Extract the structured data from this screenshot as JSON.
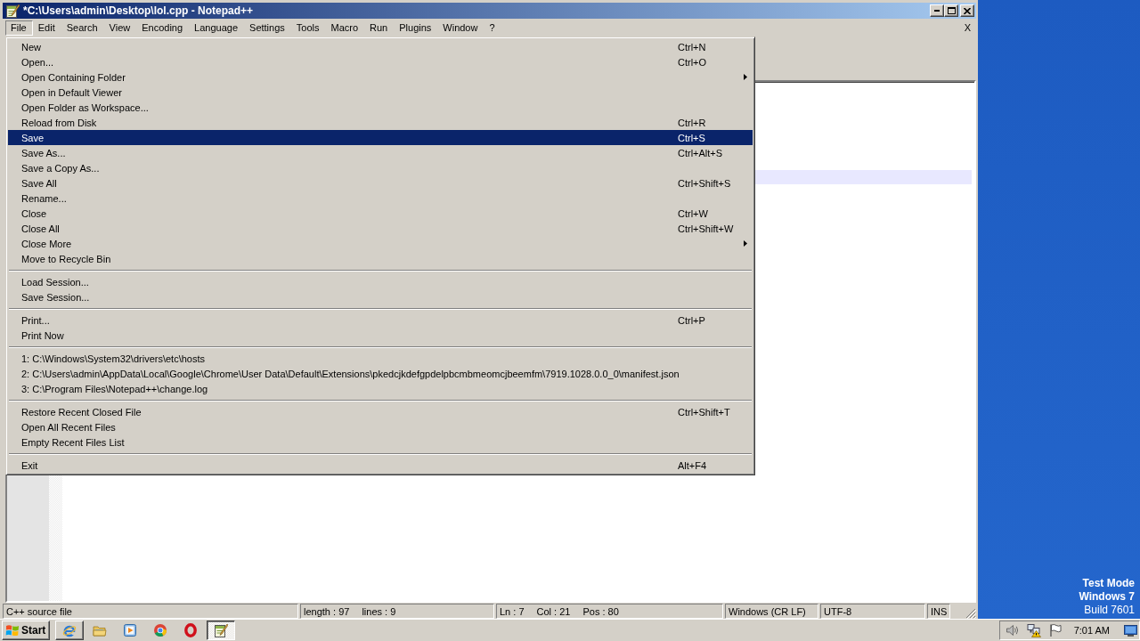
{
  "window": {
    "title": "*C:\\Users\\admin\\Desktop\\lol.cpp - Notepad++",
    "close_document": "X"
  },
  "menu_bar": [
    {
      "label": "File",
      "selected": true
    },
    {
      "label": "Edit",
      "selected": false
    },
    {
      "label": "Search",
      "selected": false
    },
    {
      "label": "View",
      "selected": false
    },
    {
      "label": "Encoding",
      "selected": false
    },
    {
      "label": "Language",
      "selected": false
    },
    {
      "label": "Settings",
      "selected": false
    },
    {
      "label": "Tools",
      "selected": false
    },
    {
      "label": "Macro",
      "selected": false
    },
    {
      "label": "Run",
      "selected": false
    },
    {
      "label": "Plugins",
      "selected": false
    },
    {
      "label": "Window",
      "selected": false
    },
    {
      "label": "?",
      "selected": false
    }
  ],
  "file_menu": {
    "sections": [
      {
        "items": [
          {
            "label": "New",
            "shortcut": "Ctrl+N",
            "submenu": false,
            "selected": false
          },
          {
            "label": "Open...",
            "shortcut": "Ctrl+O",
            "submenu": false,
            "selected": false
          },
          {
            "label": "Open Containing Folder",
            "submenu": true,
            "selected": false
          },
          {
            "label": "Open in Default Viewer",
            "submenu": false,
            "selected": false
          },
          {
            "label": "Open Folder as Workspace...",
            "submenu": false,
            "selected": false
          },
          {
            "label": "Reload from Disk",
            "shortcut": "Ctrl+R",
            "submenu": false,
            "selected": false
          },
          {
            "label": "Save",
            "shortcut": "Ctrl+S",
            "submenu": false,
            "selected": true
          },
          {
            "label": "Save As...",
            "shortcut": "Ctrl+Alt+S",
            "submenu": false,
            "selected": false
          },
          {
            "label": "Save a Copy As...",
            "submenu": false,
            "selected": false
          },
          {
            "label": "Save All",
            "shortcut": "Ctrl+Shift+S",
            "submenu": false,
            "selected": false
          },
          {
            "label": "Rename...",
            "submenu": false,
            "selected": false
          },
          {
            "label": "Close",
            "shortcut": "Ctrl+W",
            "submenu": false,
            "selected": false
          },
          {
            "label": "Close All",
            "shortcut": "Ctrl+Shift+W",
            "submenu": false,
            "selected": false
          },
          {
            "label": "Close More",
            "submenu": true,
            "selected": false
          },
          {
            "label": "Move to Recycle Bin",
            "submenu": false,
            "selected": false
          }
        ]
      },
      {
        "items": [
          {
            "label": "Load Session...",
            "submenu": false,
            "selected": false
          },
          {
            "label": "Save Session...",
            "submenu": false,
            "selected": false
          }
        ]
      },
      {
        "items": [
          {
            "label": "Print...",
            "shortcut": "Ctrl+P",
            "submenu": false,
            "selected": false
          },
          {
            "label": "Print Now",
            "submenu": false,
            "selected": false
          }
        ]
      },
      {
        "items": [
          {
            "label": "1: C:\\Windows\\System32\\drivers\\etc\\hosts",
            "submenu": false,
            "selected": false
          },
          {
            "label": "2: C:\\Users\\admin\\AppData\\Local\\Google\\Chrome\\User Data\\Default\\Extensions\\pkedcjkdefgpdelpbcmbmeomcjbeemfm\\7919.1028.0.0_0\\manifest.json",
            "submenu": false,
            "selected": false
          },
          {
            "label": "3: C:\\Program Files\\Notepad++\\change.log",
            "submenu": false,
            "selected": false
          }
        ]
      },
      {
        "items": [
          {
            "label": "Restore Recent Closed File",
            "shortcut": "Ctrl+Shift+T",
            "submenu": false,
            "selected": false
          },
          {
            "label": "Open All Recent Files",
            "submenu": false,
            "selected": false
          },
          {
            "label": "Empty Recent Files List",
            "submenu": false,
            "selected": false
          }
        ]
      },
      {
        "items": [
          {
            "label": "Exit",
            "shortcut": "Alt+F4",
            "submenu": false,
            "selected": false
          }
        ]
      }
    ]
  },
  "status_bar": [
    {
      "fields": [
        "C++ source file"
      ]
    },
    {
      "fields": [
        "length : 97",
        "lines : 9"
      ]
    },
    {
      "fields": [
        "Ln : 7",
        "Col : 21",
        "Pos : 80"
      ]
    },
    {
      "fields": [
        "Windows (CR LF)"
      ]
    },
    {
      "fields": [
        "UTF-8"
      ]
    },
    {
      "fields": [
        "INS"
      ]
    }
  ],
  "desktop": {
    "notice": [
      {
        "text": "Test Mode",
        "bold": true
      },
      {
        "text": "Windows 7",
        "bold": true
      },
      {
        "text": "Build 7601",
        "bold": false
      }
    ]
  },
  "taskbar": {
    "start": "Start",
    "buttons": [
      {
        "kind": "ie",
        "raised": true,
        "selected": false
      },
      {
        "kind": "folder",
        "raised": false,
        "selected": false
      },
      {
        "kind": "media",
        "raised": false,
        "selected": false
      },
      {
        "kind": "chrome",
        "raised": false,
        "selected": false
      },
      {
        "kind": "opera",
        "raised": false,
        "selected": false
      },
      {
        "kind": "notepad",
        "raised": false,
        "selected": true
      }
    ],
    "tray": {
      "icons": [
        {
          "kind": "speaker"
        },
        {
          "kind": "network"
        },
        {
          "kind": "flag"
        }
      ],
      "clock": "7:01 AM"
    }
  }
}
